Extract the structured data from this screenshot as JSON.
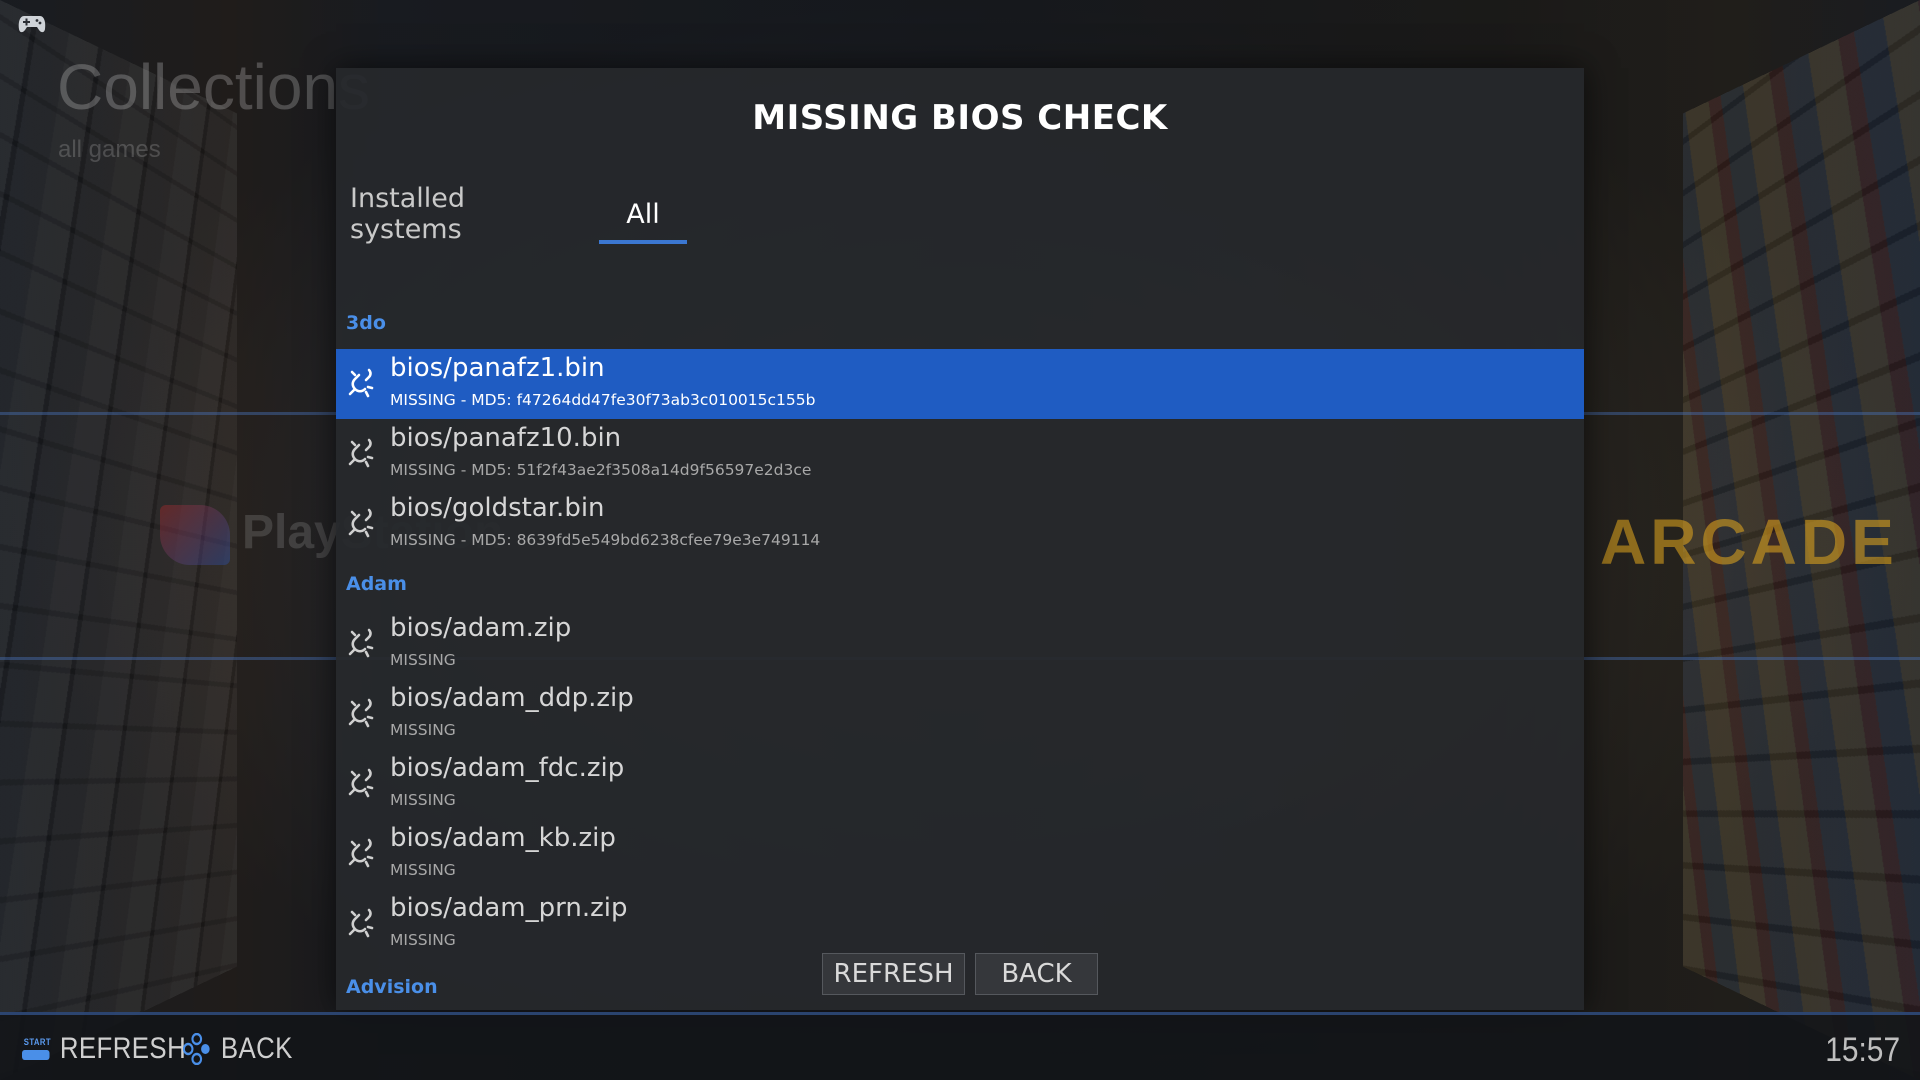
{
  "background": {
    "title": "Collections",
    "subtitle": "all games",
    "system_left": "PlayStation",
    "system_right": "ARCADE"
  },
  "dialog": {
    "title": "MISSING BIOS CHECK",
    "tabs": [
      {
        "label": "Installed systems",
        "active": false
      },
      {
        "label": "All",
        "active": true
      }
    ],
    "groups": [
      {
        "name": "3do",
        "items": [
          {
            "name": "bios/panafz1.bin",
            "status": "MISSING - MD5: f47264dd47fe30f73ab3c010015c155b",
            "selected": true
          },
          {
            "name": "bios/panafz10.bin",
            "status": "MISSING - MD5: 51f2f43ae2f3508a14d9f56597e2d3ce",
            "selected": false
          },
          {
            "name": "bios/goldstar.bin",
            "status": "MISSING - MD5: 8639fd5e549bd6238cfee79e3e749114",
            "selected": false
          }
        ]
      },
      {
        "name": "Adam",
        "items": [
          {
            "name": "bios/adam.zip",
            "status": "MISSING",
            "selected": false
          },
          {
            "name": "bios/adam_ddp.zip",
            "status": "MISSING",
            "selected": false
          },
          {
            "name": "bios/adam_fdc.zip",
            "status": "MISSING",
            "selected": false
          },
          {
            "name": "bios/adam_kb.zip",
            "status": "MISSING",
            "selected": false
          },
          {
            "name": "bios/adam_prn.zip",
            "status": "MISSING",
            "selected": false
          }
        ]
      },
      {
        "name": "Advision",
        "items": []
      }
    ],
    "buttons": {
      "refresh": "REFRESH",
      "back": "BACK"
    }
  },
  "footer": {
    "help": [
      {
        "glyph": "start-button-icon",
        "glyph_label": "START",
        "label": "REFRESH"
      },
      {
        "glyph": "dpad-buttons-icon",
        "label": "BACK"
      }
    ],
    "clock": "15:57"
  },
  "colors": {
    "accent": "#1f5cc2",
    "group_header": "#4a8fe8",
    "dialog_bg": "#26282c"
  },
  "icons": {
    "top_left": "gamepad-icon",
    "row": "broken-link-icon"
  }
}
